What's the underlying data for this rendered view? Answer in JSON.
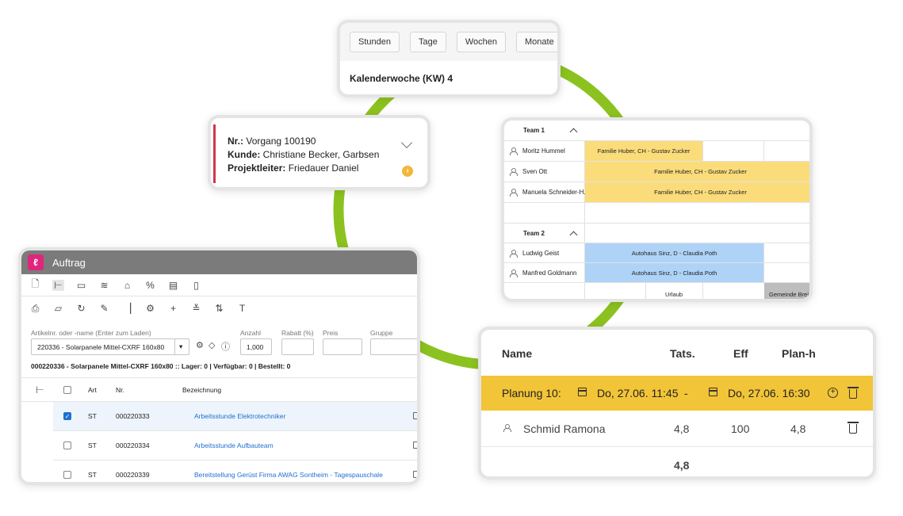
{
  "colors": {
    "ring": "#8cc21f",
    "accent_pink": "#e0257c",
    "yellow_bar": "#fbdc7a",
    "blue_bar": "#aed3f7",
    "plan_row": "#f2c438",
    "link": "#1f6fd0"
  },
  "calendar": {
    "buttons": [
      "Stunden",
      "Tage",
      "Wochen",
      "Monate"
    ],
    "week_label": "Kalenderwoche (KW) 4"
  },
  "project": {
    "nr_label": "Nr.:",
    "nr_value": "Vorgang 100190",
    "kunde_label": "Kunde:",
    "kunde_value": "Christiane Becker, Garbsen",
    "leiter_label": "Projektleiter:",
    "leiter_value": "Friedauer Daniel"
  },
  "scheduler": {
    "team1": "Team 1",
    "team2": "Team 2",
    "people": [
      "Moritz Hummel",
      "Sven Ott",
      "Manuela Schneider-H...",
      "Ludwig Geist",
      "Manfred Goldmann"
    ],
    "bars": {
      "huber_short": "Familie Huber, CH - Gustav Zucker",
      "huber_1": "Familie Huber, CH - Gustav Zucker",
      "huber_2": "Familie Huber, CH - Gustav Zucker",
      "sinz_1": "Autohaus Sinz, D - Claudia Poth",
      "sinz_2": "Autohaus Sinz, D - Claudia Poth",
      "urlaub": "Urlaub",
      "gemeinde": "Gemeinde Brei"
    }
  },
  "auftrag": {
    "title": "Auftrag",
    "logo_glyph": "ℓ",
    "article_label": "Artikelnr. oder -name (Enter zum Laden)",
    "article_value": "220336 - Solarpanele Mittel-CXRF 160x80",
    "anzahl_label": "Anzahl",
    "anzahl_value": "1,000",
    "rabatt_label": "Rabatt (%)",
    "preis_label": "Preis",
    "gruppe_label": "Gruppe",
    "info_line": "000220336 - Solarpanele Mittel-CXRF 160x80 :: Lager: 0 | Verfügbar: 0 | Bestellt: 0",
    "columns": {
      "art": "Art",
      "nr": "Nr.",
      "bez": "Bezeichnung"
    },
    "rows": [
      {
        "checked": true,
        "art": "ST",
        "nr": "000220333",
        "bez": "Arbeitsstunde Elektrotechniker"
      },
      {
        "checked": false,
        "art": "ST",
        "nr": "000220334",
        "bez": "Arbeitsstunde Aufbauteam"
      },
      {
        "checked": false,
        "art": "ST",
        "nr": "000220339",
        "bez": "Bereitstellung Gerüst Firma AWAG Sontheim - Tagespauschale"
      }
    ]
  },
  "planning": {
    "col_name": "Name",
    "col_tats": "Tats.",
    "col_eff": "Eff",
    "col_planh": "Plan-h",
    "plan_label": "Planung 10:",
    "start": "Do, 27.06. 11:45",
    "dash": "-",
    "end": "Do, 27.06. 16:30",
    "person": "Schmid Ramona",
    "tats": "4,8",
    "eff": "100",
    "planh": "4,8",
    "sum_tats": "4,8"
  }
}
